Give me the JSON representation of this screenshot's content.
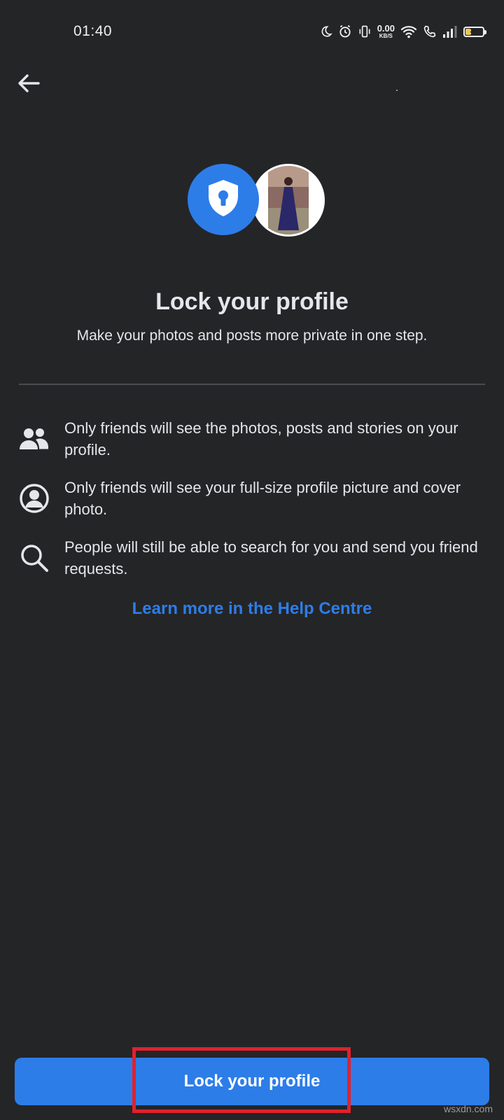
{
  "status_bar": {
    "time": "01:40",
    "net_speed_value": "0.00",
    "net_speed_unit": "KB/S",
    "battery_level": "33",
    "battery_fraction": 0.33,
    "icons": [
      "moon-icon",
      "alarm-icon",
      "vibrate-icon",
      "wifi-icon",
      "call-icon",
      "signal-icon",
      "battery-icon"
    ]
  },
  "header": {
    "back_icon": "arrow-left-icon"
  },
  "hero": {
    "shield_icon": "shield-lock-icon",
    "avatar": "profile-photo"
  },
  "title": "Lock your profile",
  "subtitle": "Make your photos and posts more private in one step.",
  "features": [
    {
      "icon": "friends-icon",
      "text": "Only friends will see the photos, posts and stories on your profile."
    },
    {
      "icon": "profile-circle-icon",
      "text": "Only friends will see your full-size profile picture and cover photo."
    },
    {
      "icon": "search-icon",
      "text": "People will still be able to search for you and send you friend requests."
    }
  ],
  "help_link": "Learn more in the Help Centre",
  "primary_button": "Lock your profile",
  "watermark": "wsxdn.com",
  "colors": {
    "background": "#242527",
    "accent": "#2d7de8",
    "text": "#e4e6eb",
    "highlight": "#e0212e"
  }
}
